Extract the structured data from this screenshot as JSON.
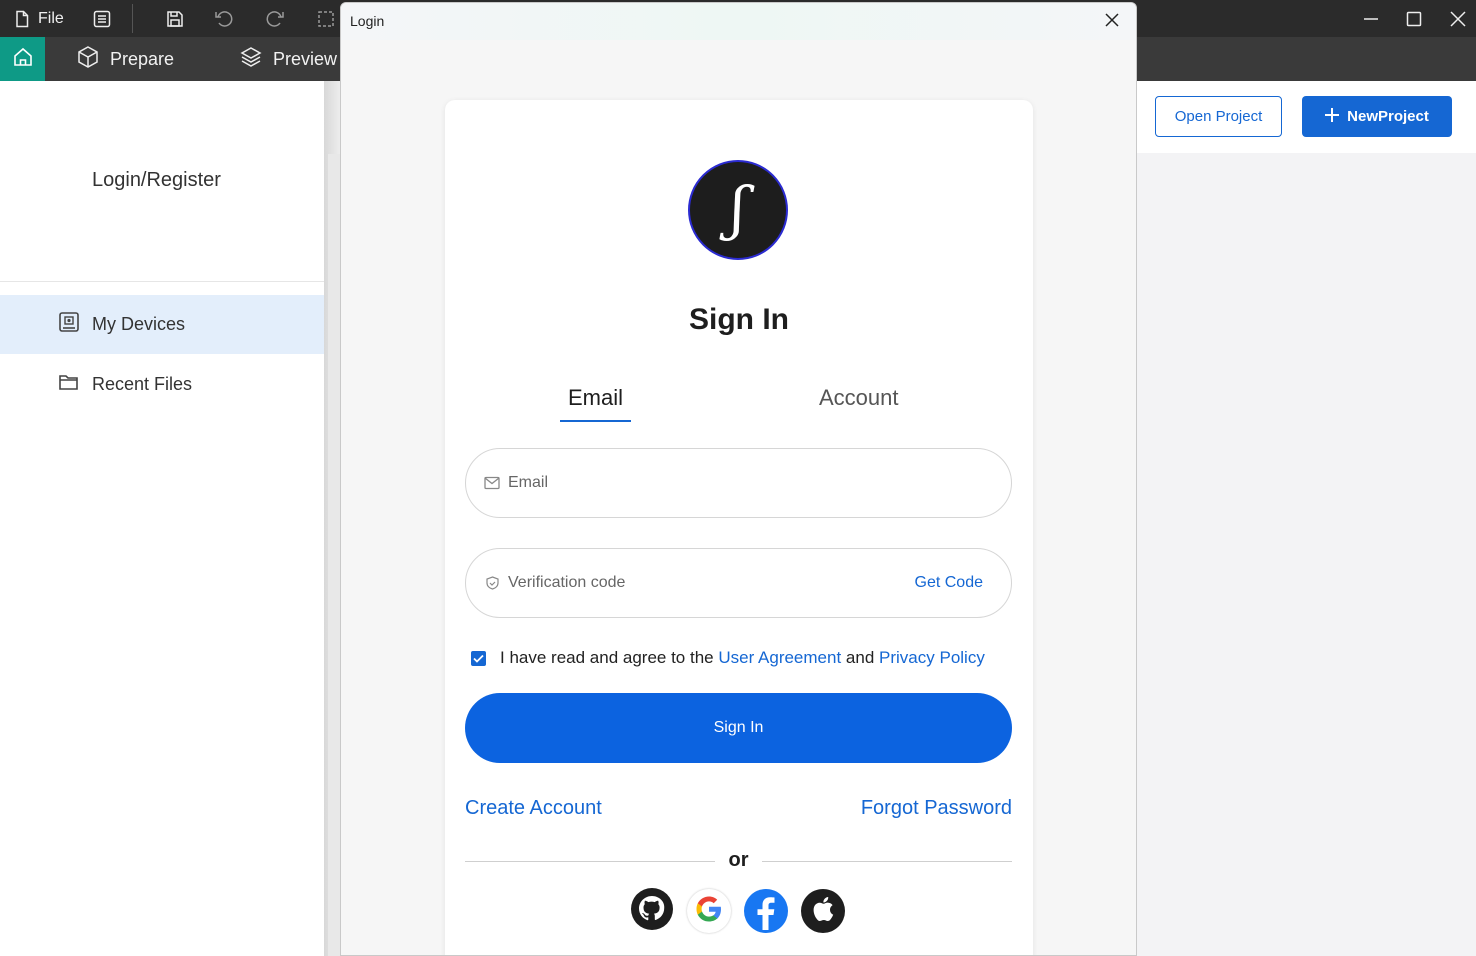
{
  "titlebar": {
    "file_label": "File"
  },
  "nav": {
    "tabs": [
      {
        "label": "Prepare"
      },
      {
        "label": "Preview"
      }
    ]
  },
  "sidebar": {
    "login_register": "Login/Register",
    "items": [
      {
        "label": "My Devices",
        "icon": "device-icon",
        "active": true
      },
      {
        "label": "Recent Files",
        "icon": "folder-icon",
        "active": false
      }
    ]
  },
  "toolbar_right": {
    "open_project": "Open Project",
    "new_project": "NewProject"
  },
  "dialog": {
    "title": "Login",
    "heading": "Sign In",
    "tabs": [
      {
        "label": "Email",
        "active": true
      },
      {
        "label": "Account",
        "active": false
      }
    ],
    "email_placeholder": "Email",
    "code_placeholder": "Verification code",
    "get_code": "Get Code",
    "agree": {
      "checked": true,
      "prefix": "I have read and agree to the",
      "user_agreement": "User Agreement",
      "and": "and",
      "privacy_policy": "Privacy Policy"
    },
    "signin_button": "Sign In",
    "create_account": "Create Account",
    "forgot_password": "Forgot Password",
    "or": "or",
    "social": [
      "github-icon",
      "google-icon",
      "facebook-icon",
      "apple-icon"
    ]
  },
  "colors": {
    "accent": "#1567d3",
    "home_tab": "#0e9a86",
    "titlebar": "#2b2b2b",
    "navbar": "#3a3a3a"
  }
}
